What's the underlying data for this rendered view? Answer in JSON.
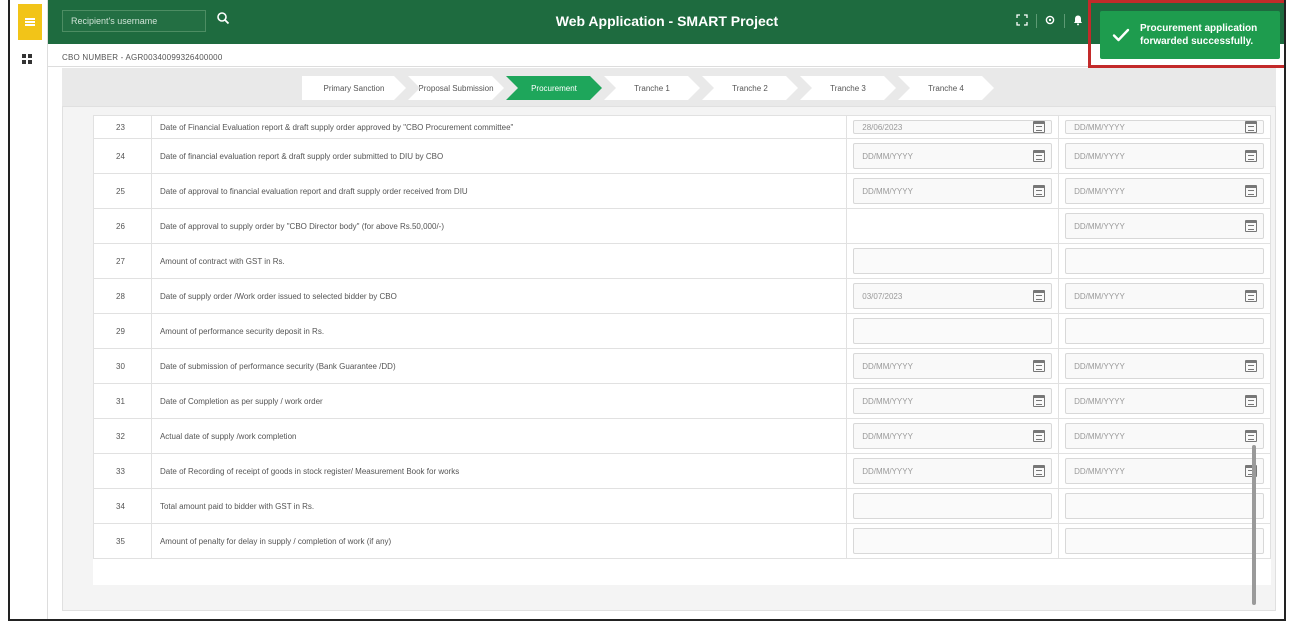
{
  "header": {
    "search_placeholder": "Recipient's username",
    "title": "Web Application - SMART Project"
  },
  "toast": {
    "message": "Procurement application forwarded successfully."
  },
  "cbo_number": "CBO NUMBER - AGR00340099326400000",
  "steps": [
    {
      "label": "Primary Sanction",
      "active": false
    },
    {
      "label": "Proposal Submission",
      "active": false
    },
    {
      "label": "Procurement",
      "active": true
    },
    {
      "label": "Tranche 1",
      "active": false
    },
    {
      "label": "Tranche 2",
      "active": false
    },
    {
      "label": "Tranche 3",
      "active": false
    },
    {
      "label": "Tranche 4",
      "active": false
    }
  ],
  "rows": [
    {
      "num": "23",
      "desc": "Date of Financial Evaluation report & draft supply order approved by \"CBO Procurement committee\"",
      "col1": "28/06/2023",
      "col1_type": "date",
      "col2": "DD/MM/YYYY",
      "col2_type": "date"
    },
    {
      "num": "24",
      "desc": "Date of financial evaluation report & draft supply order submitted to DIU by CBO",
      "col1": "DD/MM/YYYY",
      "col1_type": "date",
      "col2": "DD/MM/YYYY",
      "col2_type": "date"
    },
    {
      "num": "25",
      "desc": "Date of approval to financial evaluation report and draft supply order received from DIU",
      "col1": "DD/MM/YYYY",
      "col1_type": "date",
      "col2": "DD/MM/YYYY",
      "col2_type": "date"
    },
    {
      "num": "26",
      "desc": "Date of approval to supply order by \"CBO Director body\" (for above Rs.50,000/-)",
      "col1": "",
      "col1_type": "none",
      "col2": "DD/MM/YYYY",
      "col2_type": "date"
    },
    {
      "num": "27",
      "desc": "Amount of contract with GST in Rs.",
      "col1": "",
      "col1_type": "text",
      "col2": "",
      "col2_type": "text"
    },
    {
      "num": "28",
      "desc": "Date of supply order /Work order issued to selected bidder by CBO",
      "col1": "03/07/2023",
      "col1_type": "date",
      "col2": "DD/MM/YYYY",
      "col2_type": "date"
    },
    {
      "num": "29",
      "desc": "Amount of performance security deposit in Rs.",
      "col1": "",
      "col1_type": "text",
      "col2": "",
      "col2_type": "text"
    },
    {
      "num": "30",
      "desc": "Date of submission of performance security (Bank Guarantee /DD)",
      "col1": "DD/MM/YYYY",
      "col1_type": "date",
      "col2": "DD/MM/YYYY",
      "col2_type": "date"
    },
    {
      "num": "31",
      "desc": "Date of Completion as per supply / work order",
      "col1": "DD/MM/YYYY",
      "col1_type": "date",
      "col2": "DD/MM/YYYY",
      "col2_type": "date"
    },
    {
      "num": "32",
      "desc": "Actual date of supply /work completion",
      "col1": "DD/MM/YYYY",
      "col1_type": "date",
      "col2": "DD/MM/YYYY",
      "col2_type": "date"
    },
    {
      "num": "33",
      "desc": "Date of Recording of receipt of goods in stock register/ Measurement Book for works",
      "col1": "DD/MM/YYYY",
      "col1_type": "date",
      "col2": "DD/MM/YYYY",
      "col2_type": "date"
    },
    {
      "num": "34",
      "desc": "Total amount paid to bidder with GST in Rs.",
      "col1": "",
      "col1_type": "text",
      "col2": "",
      "col2_type": "text"
    },
    {
      "num": "35",
      "desc": "Amount of penalty for delay in supply / completion of work (if any)",
      "col1": "",
      "col1_type": "text",
      "col2": "",
      "col2_type": "text"
    }
  ],
  "colors": {
    "header_bg": "#1e6b3f",
    "step_active": "#1ea65b",
    "toast_bg": "#1e9c4e",
    "toast_border": "#c32a2a",
    "menu_button": "#f2c418"
  }
}
